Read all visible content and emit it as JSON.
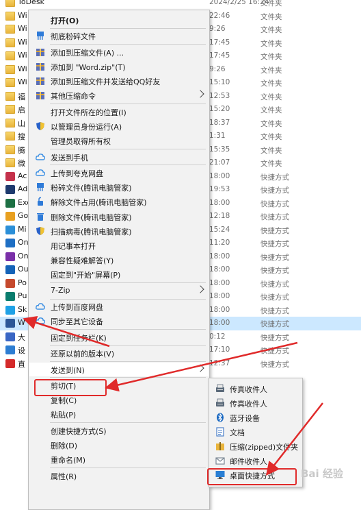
{
  "file_list": [
    {
      "name": "ToDesk",
      "date": "2024/2/25 16:24",
      "type": "文件夹",
      "icon": "folder",
      "color": "#e9b43c"
    },
    {
      "name": "Wi",
      "date": "22:46",
      "type": "文件夹",
      "icon": "folder",
      "color": "#e9b43c"
    },
    {
      "name": "Wi",
      "date": "9:26",
      "type": "文件夹",
      "icon": "folder",
      "color": "#e9b43c"
    },
    {
      "name": "Wi",
      "date": "17:45",
      "type": "文件夹",
      "icon": "folder",
      "color": "#e9b43c"
    },
    {
      "name": "Wi",
      "date": "17:45",
      "type": "文件夹",
      "icon": "folder",
      "color": "#e9b43c"
    },
    {
      "name": "Wi",
      "date": "9:26",
      "type": "文件夹",
      "icon": "folder",
      "color": "#e9b43c"
    },
    {
      "name": "Wi",
      "date": "15:10",
      "type": "文件夹",
      "icon": "folder",
      "color": "#e9b43c"
    },
    {
      "name": "福",
      "date": "12:53",
      "type": "文件夹",
      "icon": "folder",
      "color": "#e9b43c"
    },
    {
      "name": "启",
      "date": "15:20",
      "type": "文件夹",
      "icon": "folder",
      "color": "#e9b43c"
    },
    {
      "name": "山",
      "date": "18:37",
      "type": "文件夹",
      "icon": "folder",
      "color": "#e9b43c"
    },
    {
      "name": "搜",
      "date": "1:31",
      "type": "文件夹",
      "icon": "folder",
      "color": "#e9b43c"
    },
    {
      "name": "腾",
      "date": "15:35",
      "type": "文件夹",
      "icon": "folder",
      "color": "#e9b43c"
    },
    {
      "name": "微",
      "date": "21:07",
      "type": "文件夹",
      "icon": "folder",
      "color": "#e9b43c"
    },
    {
      "name": "Ac",
      "date": "18:00",
      "type": "快捷方式",
      "icon": "app",
      "color": "#c4314b"
    },
    {
      "name": "Ad",
      "date": "19:53",
      "type": "快捷方式",
      "icon": "app",
      "color": "#1e3a6e"
    },
    {
      "name": "Exc",
      "date": "18:00",
      "type": "快捷方式",
      "icon": "app",
      "color": "#1d7044"
    },
    {
      "name": "Go",
      "date": "12:18",
      "type": "快捷方式",
      "icon": "app",
      "color": "#e8a020"
    },
    {
      "name": "Mi",
      "date": "15:24",
      "type": "快捷方式",
      "icon": "app",
      "color": "#2b8fd8"
    },
    {
      "name": "On",
      "date": "11:20",
      "type": "快捷方式",
      "icon": "app",
      "color": "#1f6fc4"
    },
    {
      "name": "On",
      "date": "18:00",
      "type": "快捷方式",
      "icon": "app",
      "color": "#7a2fa8"
    },
    {
      "name": "Ou",
      "date": "18:00",
      "type": "快捷方式",
      "icon": "app",
      "color": "#1463b8"
    },
    {
      "name": "Po",
      "date": "18:00",
      "type": "快捷方式",
      "icon": "app",
      "color": "#c5492d"
    },
    {
      "name": "Pu",
      "date": "18:00",
      "type": "快捷方式",
      "icon": "app",
      "color": "#0a7d6e"
    },
    {
      "name": "Sk",
      "date": "18:00",
      "type": "快捷方式",
      "icon": "app",
      "color": "#1ea1e6"
    },
    {
      "name": "W",
      "date": "18:00",
      "type": "快捷方式",
      "icon": "app",
      "color": "#2b5797",
      "selected": true
    },
    {
      "name": "大",
      "date": "0:12",
      "type": "快捷方式",
      "icon": "app",
      "color": "#3a66c4"
    },
    {
      "name": "设",
      "date": "17:10",
      "type": "快捷方式",
      "icon": "app",
      "color": "#2d7dd2"
    },
    {
      "name": "直",
      "date": "12:37",
      "type": "快捷方式",
      "icon": "app",
      "color": "#d42a2a"
    }
  ],
  "context_menu": {
    "items": [
      {
        "label": "打开(O)",
        "bold": true,
        "icon": ""
      },
      {
        "sep": true
      },
      {
        "label": "彻底粉碎文件",
        "icon": "shredder-icon",
        "color": "#2f7bd8"
      },
      {
        "sep": true
      },
      {
        "label": "添加到压缩文件(A) ...",
        "icon": "archive-icon",
        "color": "#5a6fb8"
      },
      {
        "label": "添加到 \"Word.zip\"(T)",
        "icon": "archive-icon",
        "color": "#5a6fb8"
      },
      {
        "label": "添加到压缩文件并发送给QQ好友",
        "icon": "archive-icon",
        "color": "#5a6fb8"
      },
      {
        "label": "其他压缩命令",
        "icon": "archive-icon",
        "color": "#5a6fb8",
        "submenu": true
      },
      {
        "sep": true
      },
      {
        "label": "打开文件所在的位置(I)",
        "icon": ""
      },
      {
        "label": "以管理员身份运行(A)",
        "icon": "shield-icon",
        "color": "#2a62c9"
      },
      {
        "label": "管理员取得所有权",
        "icon": ""
      },
      {
        "sep": true
      },
      {
        "label": "发送到手机",
        "icon": "cloud-icon",
        "color": "#3b8fe3"
      },
      {
        "sep": true
      },
      {
        "label": "上传到夸克网盘",
        "icon": "cloud-icon",
        "color": "#3b8fe3"
      },
      {
        "label": "粉碎文件(腾讯电脑管家)",
        "icon": "shredder-icon",
        "color": "#2f7bd8"
      },
      {
        "label": "解除文件占用(腾讯电脑管家)",
        "icon": "unlock-icon",
        "color": "#2f7bd8"
      },
      {
        "label": "删除文件(腾讯电脑管家)",
        "icon": "delete-icon",
        "color": "#2f7bd8"
      },
      {
        "label": "扫描病毒(腾讯电脑管家)",
        "icon": "shield-icon",
        "color": "#2a62c9"
      },
      {
        "label": "用记事本打开",
        "icon": ""
      },
      {
        "label": "兼容性疑难解答(Y)",
        "icon": ""
      },
      {
        "label": "固定到\"开始\"屏幕(P)",
        "icon": ""
      },
      {
        "sep": true
      },
      {
        "label": "7-Zip",
        "icon": "",
        "submenu": true
      },
      {
        "sep": true
      },
      {
        "label": "上传到百度网盘",
        "icon": "cloud-icon",
        "color": "#3b8fe3"
      },
      {
        "label": "同步至其它设备",
        "icon": "cloud-icon",
        "color": "#3b8fe3"
      },
      {
        "sep": true
      },
      {
        "label": "固定到任务栏(K)",
        "icon": ""
      },
      {
        "sep": true
      },
      {
        "label": "还原以前的版本(V)",
        "icon": ""
      },
      {
        "sep": true
      },
      {
        "label": "发送到(N)",
        "icon": "",
        "submenu": true,
        "highlight": true
      },
      {
        "sep": true
      },
      {
        "label": "剪切(T)",
        "icon": ""
      },
      {
        "label": "复制(C)",
        "icon": ""
      },
      {
        "label": "粘贴(P)",
        "icon": ""
      },
      {
        "sep": true
      },
      {
        "label": "创建快捷方式(S)",
        "icon": ""
      },
      {
        "label": "删除(D)",
        "icon": ""
      },
      {
        "label": "重命名(M)",
        "icon": ""
      },
      {
        "sep": true
      },
      {
        "label": "属性(R)",
        "icon": ""
      }
    ]
  },
  "send_to_menu": {
    "items": [
      {
        "label": "传真收件人",
        "icon": "fax-icon",
        "color": "#5b6a7a"
      },
      {
        "label": "传真收件人",
        "icon": "fax-icon",
        "color": "#5b6a7a"
      },
      {
        "label": "蓝牙设备",
        "icon": "bluetooth-icon",
        "color": "#1565c0"
      },
      {
        "label": "文档",
        "icon": "document-icon",
        "color": "#4a7fc9"
      },
      {
        "label": "压缩(zipped)文件夹",
        "icon": "zip-folder-icon",
        "color": "#e9b43c"
      },
      {
        "label": "邮件收件人",
        "icon": "mail-icon",
        "color": "#7a8794"
      },
      {
        "label": "桌面快捷方式",
        "icon": "desktop-icon",
        "color": "#2a7fd4"
      }
    ]
  },
  "watermark": "Bai 经验",
  "colors": {
    "annotation": "#e02a2a",
    "selection": "#cce8ff",
    "menu_bg": "#f2f2f2"
  }
}
